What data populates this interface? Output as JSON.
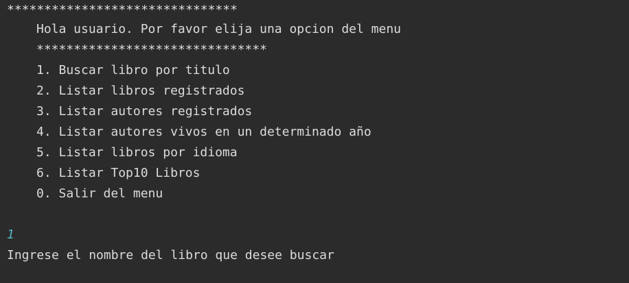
{
  "console": {
    "separator_top": "*******************************",
    "greeting": "Hola usuario. Por favor elija una opcion del menu",
    "separator_inner": "*******************************",
    "menu_items": [
      "1. Buscar libro por titulo",
      "2. Listar libros registrados",
      "3. Listar autores registrados",
      "4. Listar autores vivos en un determinado año",
      "5. Listar libros por idioma",
      "6. Listar Top10 Libros",
      "0. Salir del menu"
    ],
    "user_input": "1",
    "prompt": "Ingrese el nombre del libro que desee buscar",
    "colors": {
      "background": "#2b2b2b",
      "text": "#dcdcdc",
      "input_echo": "#56b6c2"
    }
  }
}
